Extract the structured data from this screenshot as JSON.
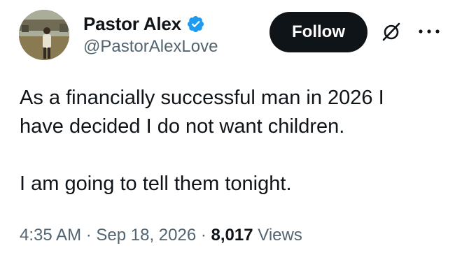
{
  "author": {
    "display_name": "Pastor Alex",
    "handle": "@PastorAlexLove",
    "verified": true,
    "verified_color": "#1d9bf0"
  },
  "actions": {
    "follow_label": "Follow",
    "grok_icon": "slashed-circle-icon",
    "more_icon": "more-dots-icon"
  },
  "tweet": {
    "line1": "As a financially successful man in 2026 I",
    "line2": "have decided I do not want children.",
    "line3": "I am going to tell them tonight."
  },
  "meta": {
    "time": "4:35 AM",
    "sep1": " · ",
    "date": "Sep 18, 2026",
    "sep2": " · ",
    "views_count": "8,017",
    "views_label": "Views"
  }
}
